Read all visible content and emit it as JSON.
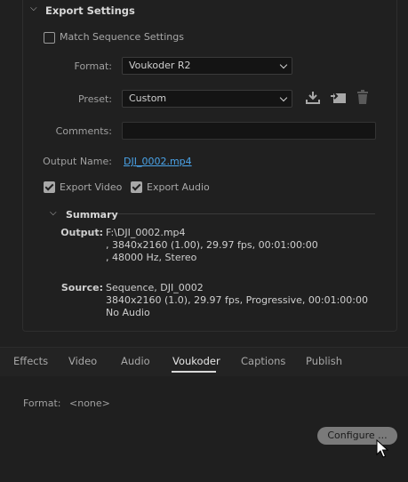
{
  "export_settings": {
    "title": "Export Settings",
    "match_sequence_label": "Match Sequence Settings",
    "format_label": "Format:",
    "format_value": "Voukoder R2",
    "preset_label": "Preset:",
    "preset_value": "Custom",
    "comments_label": "Comments:",
    "comments_value": "",
    "output_name_label": "Output Name:",
    "output_name_value": "DJI_0002.mp4",
    "export_video_label": "Export Video",
    "export_audio_label": "Export Audio",
    "match_sequence_checked": false,
    "export_video_checked": true,
    "export_audio_checked": true,
    "icons": [
      "save-preset-icon",
      "import-preset-icon",
      "delete-preset-icon"
    ]
  },
  "summary": {
    "title": "Summary",
    "output_label": "Output:",
    "output_text": "F:\\DJI_0002.mp4\n, 3840x2160 (1.00), 29.97 fps, 00:01:00:00\n, 48000 Hz, Stereo",
    "source_label": "Source:",
    "source_text": "Sequence, DJI_0002\n3840x2160 (1.0), 29.97 fps, Progressive, 00:01:00:00\nNo Audio"
  },
  "tabs": [
    {
      "label": "Effects",
      "active": false
    },
    {
      "label": "Video",
      "active": false
    },
    {
      "label": "Audio",
      "active": false
    },
    {
      "label": "Voukoder",
      "active": true
    },
    {
      "label": "Captions",
      "active": false
    },
    {
      "label": "Publish",
      "active": false
    }
  ],
  "voukoder_panel": {
    "format_label": "Format:",
    "format_value": "<none>",
    "configure_label": "Configure ..."
  }
}
